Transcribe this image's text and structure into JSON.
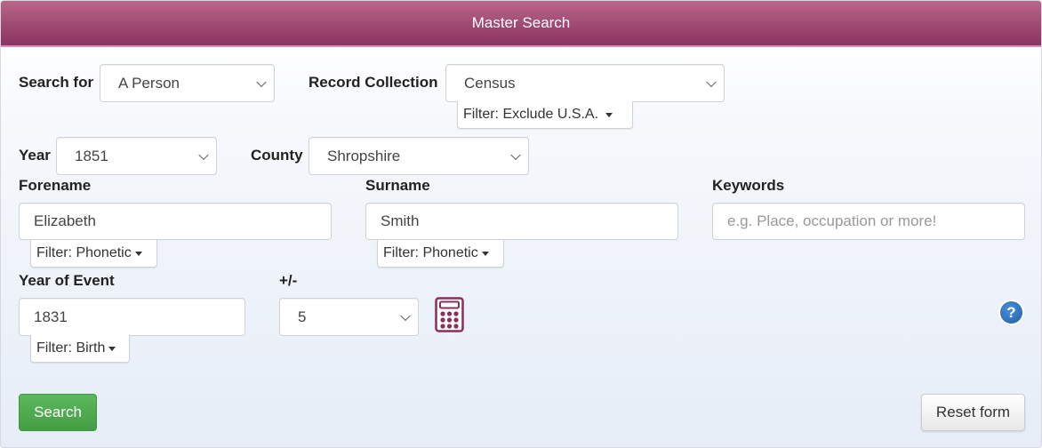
{
  "header": {
    "title": "Master Search"
  },
  "colors": {
    "header": "#9c4670",
    "search_button": "#4cae4c",
    "calculator": "#8b2e5c",
    "help": "#2a6ab8"
  },
  "form": {
    "search_for": {
      "label": "Search for",
      "value": "A Person"
    },
    "record_collection": {
      "label": "Record Collection",
      "value": "Census",
      "filter": "Filter: Exclude U.S.A."
    },
    "year": {
      "label": "Year",
      "value": "1851"
    },
    "county": {
      "label": "County",
      "value": "Shropshire"
    },
    "forename": {
      "label": "Forename",
      "value": "Elizabeth",
      "filter": "Filter: Phonetic"
    },
    "surname": {
      "label": "Surname",
      "value": "Smith",
      "filter": "Filter: Phonetic"
    },
    "keywords": {
      "label": "Keywords",
      "value": "",
      "placeholder": "e.g. Place, occupation or more!"
    },
    "year_of_event": {
      "label": "Year of Event",
      "value": "1831",
      "filter": "Filter: Birth"
    },
    "plus_minus": {
      "label": "+/-",
      "value": "5"
    }
  },
  "buttons": {
    "search": "Search",
    "reset": "Reset form",
    "help": "?"
  },
  "icons": {
    "calculator": "calculator-icon",
    "help": "question-circle-icon",
    "chevron": "chevron-down-icon",
    "caret": "caret-down-icon"
  }
}
